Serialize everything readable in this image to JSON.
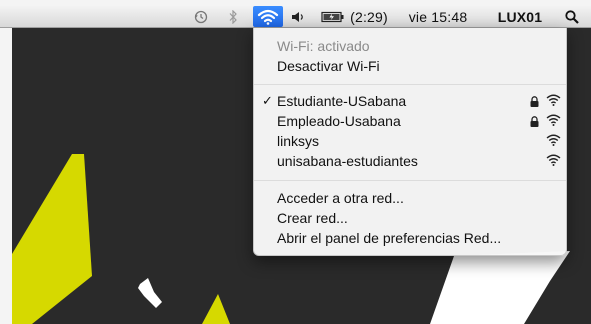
{
  "menubar": {
    "battery_time": "(2:29)",
    "datetime": "vie 15:48",
    "username": "LUX01",
    "icons": [
      "time-machine-icon",
      "bluetooth-icon",
      "wifi-icon",
      "volume-icon",
      "battery-icon",
      "spotlight-icon"
    ]
  },
  "wifi_menu": {
    "status": "Wi-Fi: activado",
    "toggle": "Desactivar Wi-Fi",
    "networks": [
      {
        "name": "Estudiante-USabana",
        "checked": true,
        "locked": true
      },
      {
        "name": "Empleado-Usabana",
        "checked": false,
        "locked": true
      },
      {
        "name": "linksys",
        "checked": false,
        "locked": false
      },
      {
        "name": "unisabana-estudiantes",
        "checked": false,
        "locked": false
      }
    ],
    "join_other": "Acceder a otra red...",
    "create": "Crear red...",
    "open_prefs": "Abrir el panel de preferencias Red..."
  },
  "colors": {
    "menubar_highlight": "#2a79f2",
    "wallpaper": "#2a2a2a",
    "accent_shape": "#d6d900"
  }
}
